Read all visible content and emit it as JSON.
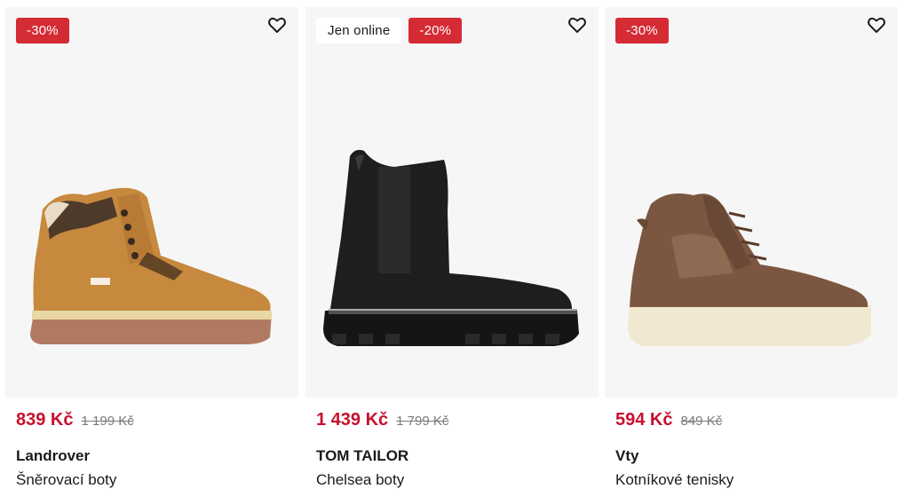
{
  "products": [
    {
      "badges": [
        "-30%"
      ],
      "online_label": "",
      "price": "839 Kč",
      "old_price": "1 199 Kč",
      "brand": "Landrover",
      "type": "Šněrovací boty",
      "image": "tan-lace-up-boot"
    },
    {
      "online_label": "Jen online",
      "badges": [
        "-20%"
      ],
      "price": "1 439 Kč",
      "old_price": "1 799 Kč",
      "brand": "TOM TAILOR",
      "type": "Chelsea boty",
      "image": "black-chelsea-boot"
    },
    {
      "badges": [
        "-30%"
      ],
      "online_label": "",
      "price": "594 Kč",
      "old_price": "849 Kč",
      "brand": "Vty",
      "type": "Kotníkové tenisky",
      "image": "brown-high-top-sneaker"
    }
  ],
  "colors": {
    "badge_discount": "#d52b35",
    "price": "#c8102e",
    "image_bg": "#f6f6f6"
  },
  "icons": {
    "favorite": "heart-outline-icon"
  }
}
